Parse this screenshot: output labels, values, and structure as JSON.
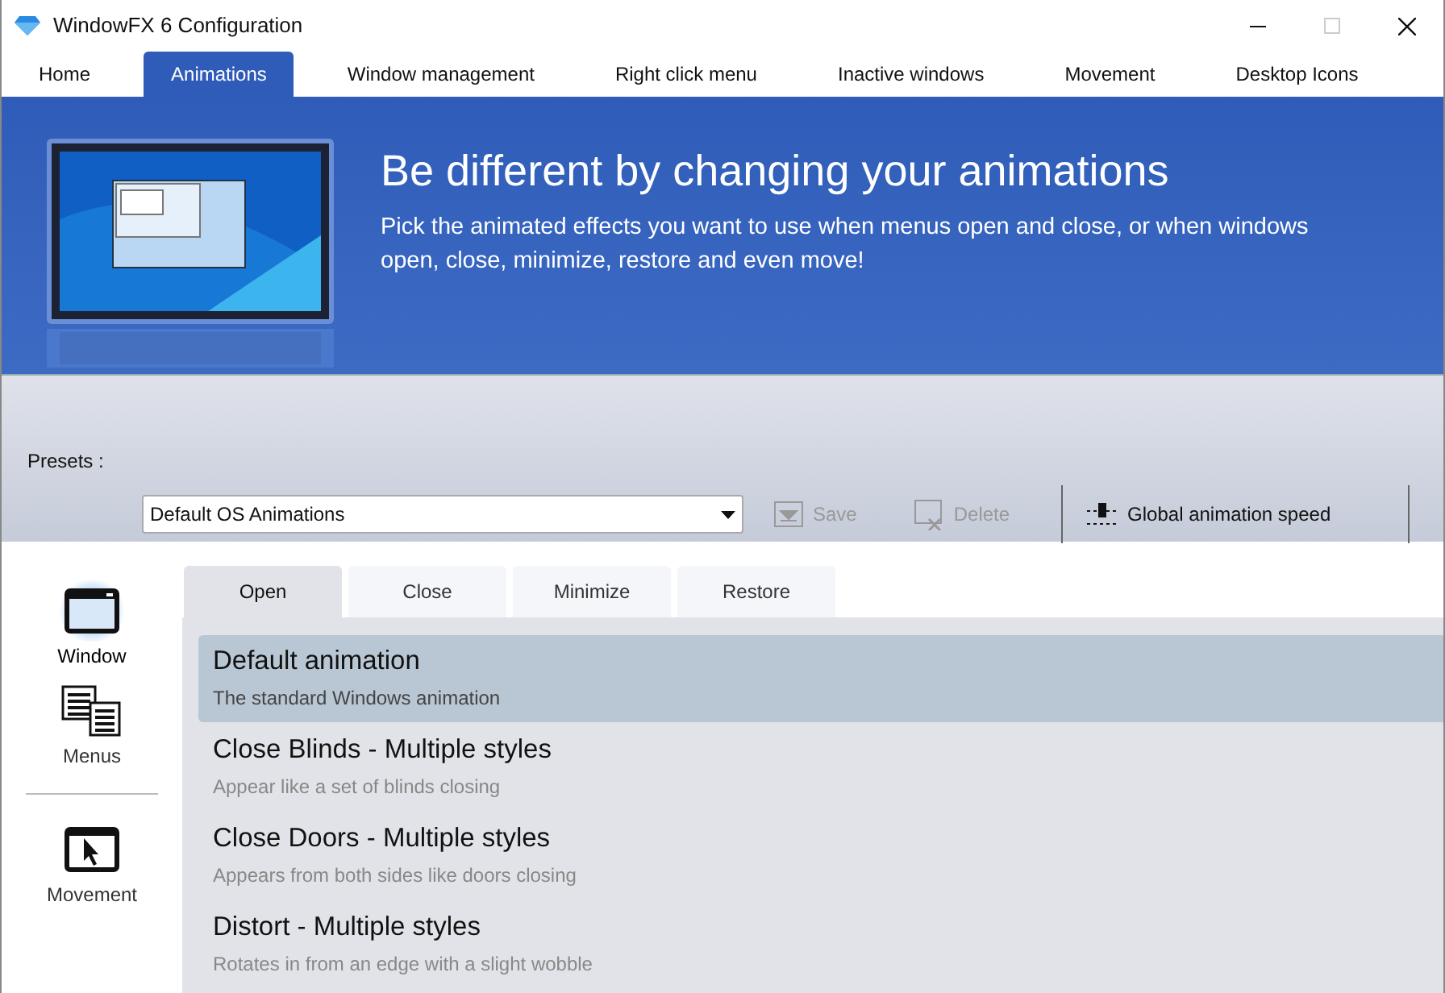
{
  "window": {
    "title": "WindowFX 6 Configuration"
  },
  "tabs": [
    {
      "label": "Home",
      "selected": false
    },
    {
      "label": "Animations",
      "selected": true
    },
    {
      "label": "Window management",
      "selected": false
    },
    {
      "label": "Right click menu",
      "selected": false
    },
    {
      "label": "Inactive windows",
      "selected": false
    },
    {
      "label": "Movement",
      "selected": false
    },
    {
      "label": "Desktop Icons",
      "selected": false
    }
  ],
  "banner": {
    "heading": "Be different by changing your animations",
    "text": "Pick the animated effects you want to use when menus open and close, or when windows open, close, minimize, restore and even move!"
  },
  "presets": {
    "label": "Presets :",
    "value": "Default OS Animations",
    "save": {
      "label": "Save",
      "disabled": true
    },
    "delete": {
      "label": "Delete",
      "disabled": true
    },
    "speed": "Global animation speed"
  },
  "sidebar": {
    "items": [
      {
        "kind": "window",
        "label": "Window",
        "selected": true
      },
      {
        "kind": "menus",
        "label": "Menus",
        "selected": false
      },
      {
        "kind": "movement",
        "label": "Movement",
        "selected": false
      }
    ]
  },
  "subtabs": [
    {
      "label": "Open",
      "selected": true
    },
    {
      "label": "Close",
      "selected": false
    },
    {
      "label": "Minimize",
      "selected": false
    },
    {
      "label": "Restore",
      "selected": false
    }
  ],
  "animations": [
    {
      "name": "Default animation",
      "description": "The standard Windows animation",
      "selected": true
    },
    {
      "name": "Close Blinds - Multiple styles",
      "description": "Appear like a set of blinds closing",
      "selected": false
    },
    {
      "name": "Close Doors - Multiple styles",
      "description": "Appears from both sides like doors closing",
      "selected": false
    },
    {
      "name": "Distort - Multiple styles",
      "description": "Rotates in from an edge with a slight wobble",
      "selected": false
    }
  ]
}
